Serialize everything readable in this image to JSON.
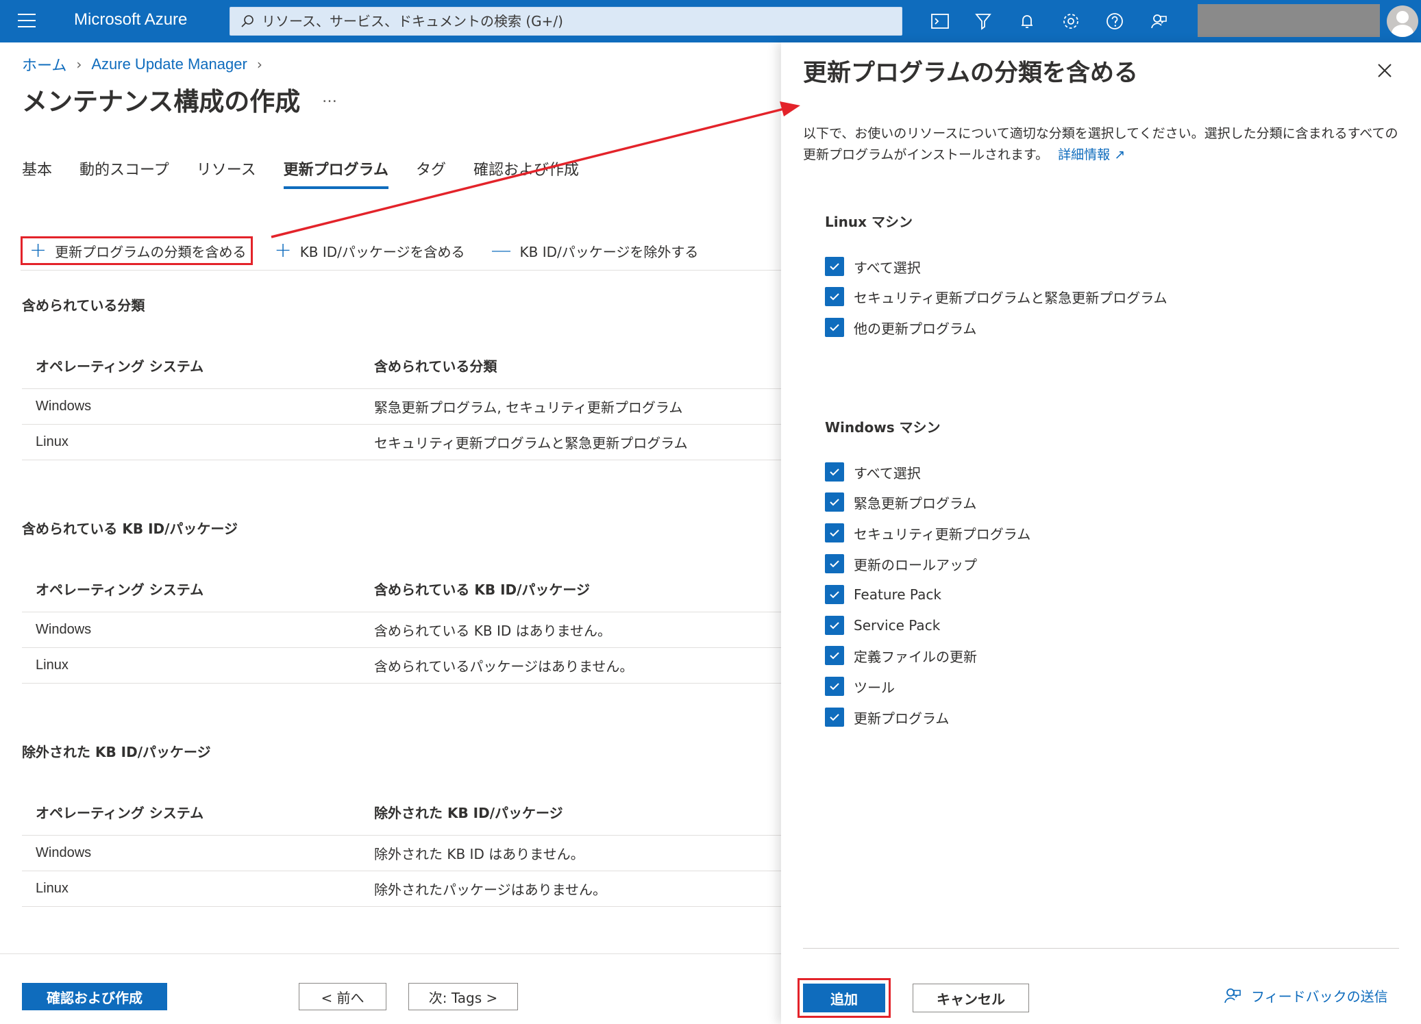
{
  "topbar": {
    "brand": "Microsoft Azure",
    "search_placeholder": "リソース、サービス、ドキュメントの検索 (G+/)",
    "icons": [
      "cloud-shell-icon",
      "directory-filter-icon",
      "notifications-icon",
      "settings-icon",
      "help-icon",
      "feedback-icon"
    ]
  },
  "breadcrumb": {
    "home": "ホーム",
    "service": "Azure Update Manager"
  },
  "page": {
    "title": "メンテナンス構成の作成",
    "more": "…"
  },
  "tabs": [
    {
      "label": "基本",
      "active": false
    },
    {
      "label": "動的スコープ",
      "active": false
    },
    {
      "label": "リソース",
      "active": false
    },
    {
      "label": "更新プログラム",
      "active": true
    },
    {
      "label": "タグ",
      "active": false
    },
    {
      "label": "確認および作成",
      "active": false
    }
  ],
  "commands": {
    "include_classification": "更新プログラムの分類を含める",
    "include_kb": "KB ID/パッケージを含める",
    "exclude_kb": "KB ID/パッケージを除外する"
  },
  "sections": [
    {
      "title": "含められている分類",
      "col1": "オペレーティング システム",
      "col2": "含められている分類",
      "rows": [
        [
          "Windows",
          "緊急更新プログラム, セキュリティ更新プログラム"
        ],
        [
          "Linux",
          "セキュリティ更新プログラムと緊急更新プログラム"
        ]
      ]
    },
    {
      "title": "含められている KB ID/パッケージ",
      "col1": "オペレーティング システム",
      "col2": "含められている KB ID/パッケージ",
      "rows": [
        [
          "Windows",
          "含められている KB ID はありません。"
        ],
        [
          "Linux",
          "含められているパッケージはありません。"
        ]
      ]
    },
    {
      "title": "除外された KB ID/パッケージ",
      "col1": "オペレーティング システム",
      "col2": "除外された KB ID/パッケージ",
      "rows": [
        [
          "Windows",
          "除外された KB ID はありません。"
        ],
        [
          "Linux",
          "除外されたパッケージはありません。"
        ]
      ]
    }
  ],
  "footer": {
    "review_create": "確認および作成",
    "previous": "< 前へ",
    "next": "次: Tags >"
  },
  "panel": {
    "title": "更新プログラムの分類を含める",
    "description": "以下で、お使いのリソースについて適切な分類を選択してください。選択した分類に含まれるすべての更新プログラムがインストールされます。",
    "learn_more": "詳細情報",
    "linux_group": "Linux マシン",
    "linux_items": [
      {
        "label": "すべて選択",
        "checked": true
      },
      {
        "label": "セキュリティ更新プログラムと緊急更新プログラム",
        "checked": true
      },
      {
        "label": "他の更新プログラム",
        "checked": true
      }
    ],
    "windows_group": "Windows マシン",
    "windows_items": [
      {
        "label": "すべて選択",
        "checked": true
      },
      {
        "label": "緊急更新プログラム",
        "checked": true
      },
      {
        "label": "セキュリティ更新プログラム",
        "checked": true
      },
      {
        "label": "更新のロールアップ",
        "checked": true
      },
      {
        "label": "Feature Pack",
        "checked": true
      },
      {
        "label": "Service Pack",
        "checked": true
      },
      {
        "label": "定義ファイルの更新",
        "checked": true
      },
      {
        "label": "ツール",
        "checked": true
      },
      {
        "label": "更新プログラム",
        "checked": true
      }
    ],
    "add": "追加",
    "cancel": "キャンセル",
    "feedback": "フィードバックの送信"
  },
  "colors": {
    "accent": "#0f6cbd",
    "highlight": "#e3232a"
  }
}
